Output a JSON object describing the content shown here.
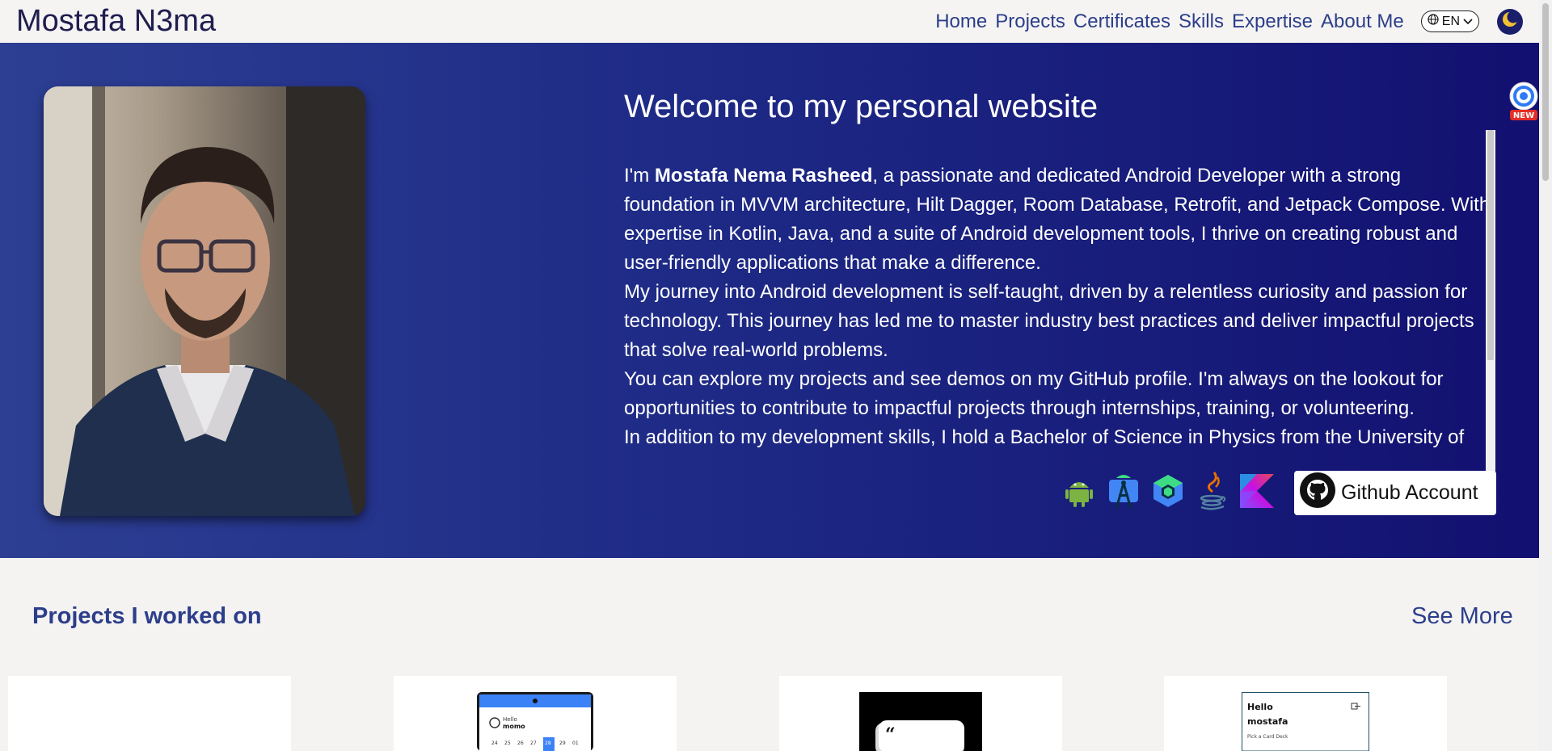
{
  "brand": "Mostafa N3ma",
  "nav": {
    "items": [
      {
        "label": "Home"
      },
      {
        "label": "Projects"
      },
      {
        "label": "Certificates"
      },
      {
        "label": "Skills"
      },
      {
        "label": "Expertise"
      },
      {
        "label": "About Me"
      }
    ],
    "language": "EN",
    "theme_toggle_icon": "moon-icon"
  },
  "hero": {
    "title": "Welcome to my personal website",
    "intro_prefix": "I'm ",
    "intro_name": "Mostafa Nema Rasheed",
    "intro_rest": ", a passionate and dedicated Android Developer with a strong foundation in MVVM architecture, Hilt Dagger, Room Database, Retrofit, and Jetpack Compose. With expertise in Kotlin, Java, and a suite of Android development tools, I thrive on creating robust and user-friendly applications that make a difference.",
    "paragraph2": "My journey into Android development is self-taught, driven by a relentless curiosity and passion for technology. This journey has led me to master industry best practices and deliver impactful projects that solve real-world problems.",
    "paragraph3": "You can explore my projects and see demos on my GitHub profile. I'm always on the lookout for opportunities to contribute to impactful projects through internships, training, or volunteering.",
    "paragraph4": "In addition to my development skills, I hold a Bachelor of Science in Physics from the University of",
    "tech_icons": [
      "android-icon",
      "android-studio-icon",
      "jetpack-compose-icon",
      "java-icon",
      "kotlin-icon"
    ],
    "github_label": "Github Account",
    "widget_badge": "NEW"
  },
  "projects": {
    "heading": "Projects I worked on",
    "see_more": "See More",
    "cards": [
      {
        "texts": []
      },
      {
        "texts": [
          "Hello",
          "momo",
          "24",
          "25",
          "26",
          "27",
          "28",
          "29",
          "01"
        ]
      },
      {
        "texts": [
          "“"
        ]
      },
      {
        "texts": [
          "Hello",
          "mostafa",
          "Pick a Card Deck"
        ]
      }
    ]
  },
  "colors": {
    "accent": "#2c3e8a",
    "hero_start": "#2d3f92",
    "hero_end": "#121070",
    "brand_text": "#1f1d4f"
  }
}
